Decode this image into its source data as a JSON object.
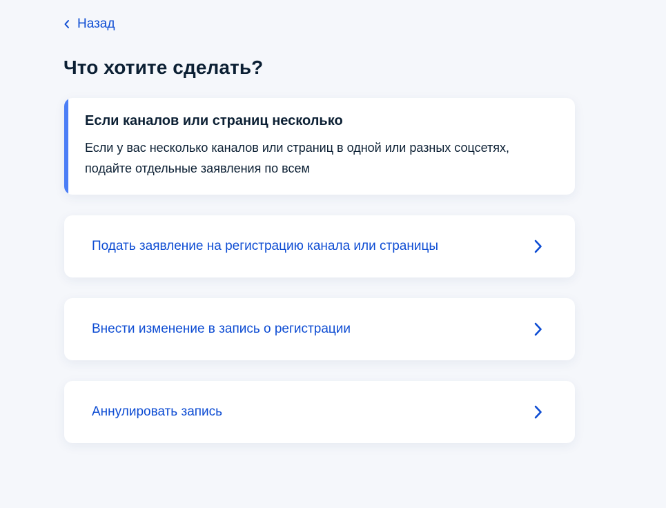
{
  "nav": {
    "back_label": "Назад"
  },
  "page": {
    "title": "Что хотите сделать?"
  },
  "info": {
    "title": "Если каналов или страниц несколько",
    "text_line1": "Если у вас несколько каналов или страниц в одной или разных соцсетях,",
    "text_line2": "подайте отдельные заявления по всем"
  },
  "options": [
    {
      "label": "Подать заявление на регистрацию канала или страницы",
      "icon": "chevron-right-icon"
    },
    {
      "label": "Внести изменение в запись о регистрации",
      "icon": "chevron-right-icon"
    },
    {
      "label": "Аннулировать запись",
      "icon": "chevron-right-icon"
    }
  ],
  "colors": {
    "background": "#f5f7fb",
    "link": "#0d4cd3",
    "text": "#0b1f33",
    "accent": "#4b7ef6",
    "card": "#ffffff"
  }
}
